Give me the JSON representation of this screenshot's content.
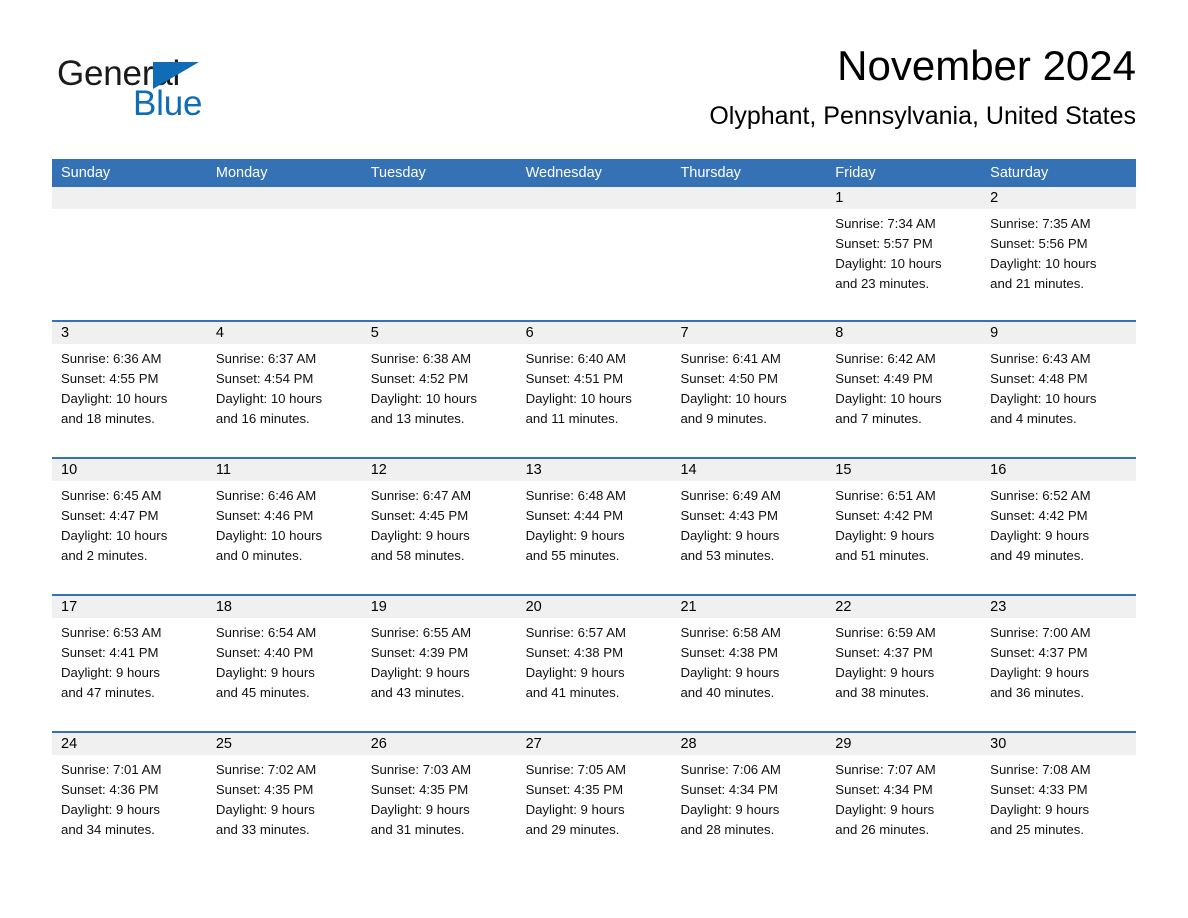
{
  "brand": {
    "name_part1": "General",
    "name_part2": "Blue",
    "accent_color": "#0f6cb5"
  },
  "header": {
    "title": "November 2024",
    "location": "Olyphant, Pennsylvania, United States"
  },
  "theme": {
    "header_blue": "#3572b5",
    "daynum_band": "#f0f0f0",
    "divider_blue": "#3572b5"
  },
  "calendar": {
    "weekday_headers": [
      "Sunday",
      "Monday",
      "Tuesday",
      "Wednesday",
      "Thursday",
      "Friday",
      "Saturday"
    ],
    "weeks": [
      [
        {
          "day": "",
          "sunrise": "",
          "sunset": "",
          "daylight_line1": "",
          "daylight_line2": "",
          "empty": true
        },
        {
          "day": "",
          "sunrise": "",
          "sunset": "",
          "daylight_line1": "",
          "daylight_line2": "",
          "empty": true
        },
        {
          "day": "",
          "sunrise": "",
          "sunset": "",
          "daylight_line1": "",
          "daylight_line2": "",
          "empty": true
        },
        {
          "day": "",
          "sunrise": "",
          "sunset": "",
          "daylight_line1": "",
          "daylight_line2": "",
          "empty": true
        },
        {
          "day": "",
          "sunrise": "",
          "sunset": "",
          "daylight_line1": "",
          "daylight_line2": "",
          "empty": true
        },
        {
          "day": "1",
          "sunrise": "Sunrise: 7:34 AM",
          "sunset": "Sunset: 5:57 PM",
          "daylight_line1": "Daylight: 10 hours",
          "daylight_line2": "and 23 minutes.",
          "empty": false
        },
        {
          "day": "2",
          "sunrise": "Sunrise: 7:35 AM",
          "sunset": "Sunset: 5:56 PM",
          "daylight_line1": "Daylight: 10 hours",
          "daylight_line2": "and 21 minutes.",
          "empty": false
        }
      ],
      [
        {
          "day": "3",
          "sunrise": "Sunrise: 6:36 AM",
          "sunset": "Sunset: 4:55 PM",
          "daylight_line1": "Daylight: 10 hours",
          "daylight_line2": "and 18 minutes.",
          "empty": false
        },
        {
          "day": "4",
          "sunrise": "Sunrise: 6:37 AM",
          "sunset": "Sunset: 4:54 PM",
          "daylight_line1": "Daylight: 10 hours",
          "daylight_line2": "and 16 minutes.",
          "empty": false
        },
        {
          "day": "5",
          "sunrise": "Sunrise: 6:38 AM",
          "sunset": "Sunset: 4:52 PM",
          "daylight_line1": "Daylight: 10 hours",
          "daylight_line2": "and 13 minutes.",
          "empty": false
        },
        {
          "day": "6",
          "sunrise": "Sunrise: 6:40 AM",
          "sunset": "Sunset: 4:51 PM",
          "daylight_line1": "Daylight: 10 hours",
          "daylight_line2": "and 11 minutes.",
          "empty": false
        },
        {
          "day": "7",
          "sunrise": "Sunrise: 6:41 AM",
          "sunset": "Sunset: 4:50 PM",
          "daylight_line1": "Daylight: 10 hours",
          "daylight_line2": "and 9 minutes.",
          "empty": false
        },
        {
          "day": "8",
          "sunrise": "Sunrise: 6:42 AM",
          "sunset": "Sunset: 4:49 PM",
          "daylight_line1": "Daylight: 10 hours",
          "daylight_line2": "and 7 minutes.",
          "empty": false
        },
        {
          "day": "9",
          "sunrise": "Sunrise: 6:43 AM",
          "sunset": "Sunset: 4:48 PM",
          "daylight_line1": "Daylight: 10 hours",
          "daylight_line2": "and 4 minutes.",
          "empty": false
        }
      ],
      [
        {
          "day": "10",
          "sunrise": "Sunrise: 6:45 AM",
          "sunset": "Sunset: 4:47 PM",
          "daylight_line1": "Daylight: 10 hours",
          "daylight_line2": "and 2 minutes.",
          "empty": false
        },
        {
          "day": "11",
          "sunrise": "Sunrise: 6:46 AM",
          "sunset": "Sunset: 4:46 PM",
          "daylight_line1": "Daylight: 10 hours",
          "daylight_line2": "and 0 minutes.",
          "empty": false
        },
        {
          "day": "12",
          "sunrise": "Sunrise: 6:47 AM",
          "sunset": "Sunset: 4:45 PM",
          "daylight_line1": "Daylight: 9 hours",
          "daylight_line2": "and 58 minutes.",
          "empty": false
        },
        {
          "day": "13",
          "sunrise": "Sunrise: 6:48 AM",
          "sunset": "Sunset: 4:44 PM",
          "daylight_line1": "Daylight: 9 hours",
          "daylight_line2": "and 55 minutes.",
          "empty": false
        },
        {
          "day": "14",
          "sunrise": "Sunrise: 6:49 AM",
          "sunset": "Sunset: 4:43 PM",
          "daylight_line1": "Daylight: 9 hours",
          "daylight_line2": "and 53 minutes.",
          "empty": false
        },
        {
          "day": "15",
          "sunrise": "Sunrise: 6:51 AM",
          "sunset": "Sunset: 4:42 PM",
          "daylight_line1": "Daylight: 9 hours",
          "daylight_line2": "and 51 minutes.",
          "empty": false
        },
        {
          "day": "16",
          "sunrise": "Sunrise: 6:52 AM",
          "sunset": "Sunset: 4:42 PM",
          "daylight_line1": "Daylight: 9 hours",
          "daylight_line2": "and 49 minutes.",
          "empty": false
        }
      ],
      [
        {
          "day": "17",
          "sunrise": "Sunrise: 6:53 AM",
          "sunset": "Sunset: 4:41 PM",
          "daylight_line1": "Daylight: 9 hours",
          "daylight_line2": "and 47 minutes.",
          "empty": false
        },
        {
          "day": "18",
          "sunrise": "Sunrise: 6:54 AM",
          "sunset": "Sunset: 4:40 PM",
          "daylight_line1": "Daylight: 9 hours",
          "daylight_line2": "and 45 minutes.",
          "empty": false
        },
        {
          "day": "19",
          "sunrise": "Sunrise: 6:55 AM",
          "sunset": "Sunset: 4:39 PM",
          "daylight_line1": "Daylight: 9 hours",
          "daylight_line2": "and 43 minutes.",
          "empty": false
        },
        {
          "day": "20",
          "sunrise": "Sunrise: 6:57 AM",
          "sunset": "Sunset: 4:38 PM",
          "daylight_line1": "Daylight: 9 hours",
          "daylight_line2": "and 41 minutes.",
          "empty": false
        },
        {
          "day": "21",
          "sunrise": "Sunrise: 6:58 AM",
          "sunset": "Sunset: 4:38 PM",
          "daylight_line1": "Daylight: 9 hours",
          "daylight_line2": "and 40 minutes.",
          "empty": false
        },
        {
          "day": "22",
          "sunrise": "Sunrise: 6:59 AM",
          "sunset": "Sunset: 4:37 PM",
          "daylight_line1": "Daylight: 9 hours",
          "daylight_line2": "and 38 minutes.",
          "empty": false
        },
        {
          "day": "23",
          "sunrise": "Sunrise: 7:00 AM",
          "sunset": "Sunset: 4:37 PM",
          "daylight_line1": "Daylight: 9 hours",
          "daylight_line2": "and 36 minutes.",
          "empty": false
        }
      ],
      [
        {
          "day": "24",
          "sunrise": "Sunrise: 7:01 AM",
          "sunset": "Sunset: 4:36 PM",
          "daylight_line1": "Daylight: 9 hours",
          "daylight_line2": "and 34 minutes.",
          "empty": false
        },
        {
          "day": "25",
          "sunrise": "Sunrise: 7:02 AM",
          "sunset": "Sunset: 4:35 PM",
          "daylight_line1": "Daylight: 9 hours",
          "daylight_line2": "and 33 minutes.",
          "empty": false
        },
        {
          "day": "26",
          "sunrise": "Sunrise: 7:03 AM",
          "sunset": "Sunset: 4:35 PM",
          "daylight_line1": "Daylight: 9 hours",
          "daylight_line2": "and 31 minutes.",
          "empty": false
        },
        {
          "day": "27",
          "sunrise": "Sunrise: 7:05 AM",
          "sunset": "Sunset: 4:35 PM",
          "daylight_line1": "Daylight: 9 hours",
          "daylight_line2": "and 29 minutes.",
          "empty": false
        },
        {
          "day": "28",
          "sunrise": "Sunrise: 7:06 AM",
          "sunset": "Sunset: 4:34 PM",
          "daylight_line1": "Daylight: 9 hours",
          "daylight_line2": "and 28 minutes.",
          "empty": false
        },
        {
          "day": "29",
          "sunrise": "Sunrise: 7:07 AM",
          "sunset": "Sunset: 4:34 PM",
          "daylight_line1": "Daylight: 9 hours",
          "daylight_line2": "and 26 minutes.",
          "empty": false
        },
        {
          "day": "30",
          "sunrise": "Sunrise: 7:08 AM",
          "sunset": "Sunset: 4:33 PM",
          "daylight_line1": "Daylight: 9 hours",
          "daylight_line2": "and 25 minutes.",
          "empty": false
        }
      ]
    ]
  }
}
